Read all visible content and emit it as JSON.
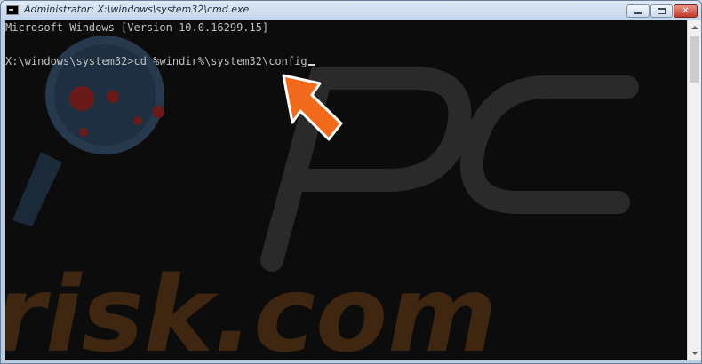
{
  "window": {
    "title": "Administrator: X:\\windows\\system32\\cmd.exe",
    "icon": "cmd-icon"
  },
  "caption_buttons": {
    "minimize_icon": "minimize-icon",
    "maximize_icon": "maximize-icon",
    "close_icon": "close-icon",
    "close_glyph": "✕"
  },
  "console": {
    "lines": [
      "Microsoft Windows [Version 10.0.16299.15]",
      "X:\\windows\\system32>cd %windir%\\system32\\config"
    ],
    "text_color": "#c0c0c0",
    "background": "#0c0c0c"
  },
  "annotation": {
    "icon": "pointer-arrow-icon",
    "color": "#f26b1d"
  },
  "watermark": {
    "text": "risk.com"
  }
}
